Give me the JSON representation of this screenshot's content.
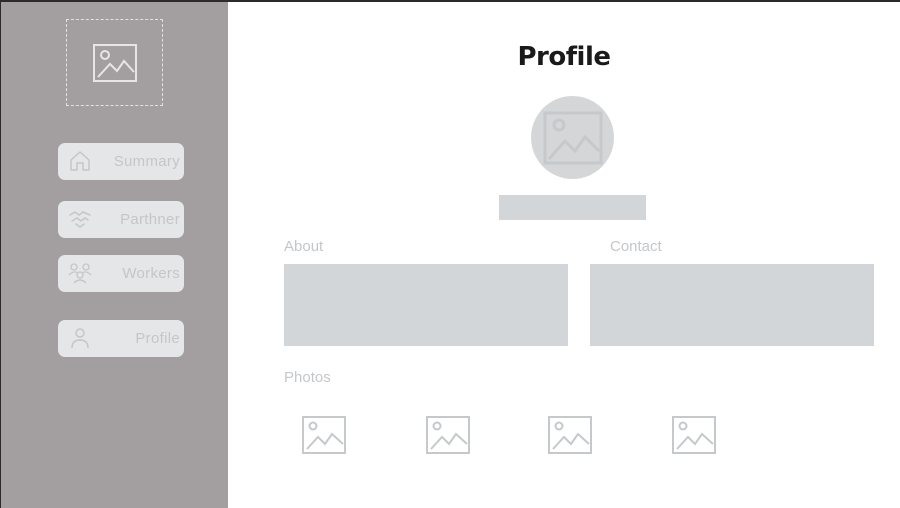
{
  "sidebar": {
    "logo": {
      "icon": "image-placeholder-icon"
    },
    "items": [
      {
        "label": "Summary",
        "icon": "home-icon"
      },
      {
        "label": "Parthner",
        "icon": "handshake-icon"
      },
      {
        "label": "Workers",
        "icon": "users-icon"
      },
      {
        "label": "Profile",
        "icon": "user-icon"
      }
    ]
  },
  "main": {
    "title": "Profile",
    "avatar_icon": "image-placeholder-icon",
    "sections": {
      "about": "About",
      "contact": "Contact",
      "photos": "Photos"
    },
    "photo_icons": [
      "image-placeholder-icon",
      "image-placeholder-icon",
      "image-placeholder-icon",
      "image-placeholder-icon"
    ]
  },
  "colors": {
    "sidebar_bg": "#a39fa0",
    "button_bg": "#e4e6e8",
    "placeholder_fill": "#d2d6d9",
    "muted_text": "#c4c7ca",
    "title_text": "#1a1a1a"
  }
}
